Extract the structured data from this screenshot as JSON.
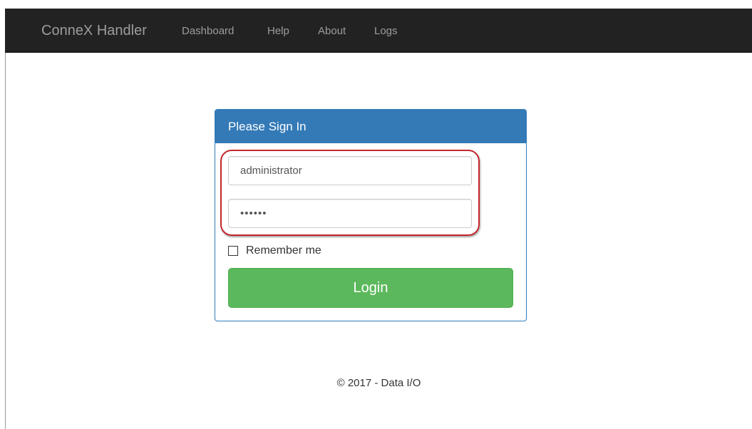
{
  "navbar": {
    "brand": "ConneX Handler",
    "links": [
      "Dashboard",
      "Help",
      "About",
      "Logs"
    ]
  },
  "login_panel": {
    "title": "Please Sign In",
    "username": {
      "value": "administrator"
    },
    "password": {
      "value": "••••••"
    },
    "remember_label": "Remember me",
    "remember_checked": false,
    "login_button": "Login"
  },
  "footer": {
    "text": "© 2017 - Data I/O"
  },
  "colors": {
    "navbar": "#222222",
    "nav_text": "#9d9d9d",
    "panel_primary": "#337ab7",
    "login_green": "#5cb85c",
    "highlight_red": "#c1272d"
  }
}
